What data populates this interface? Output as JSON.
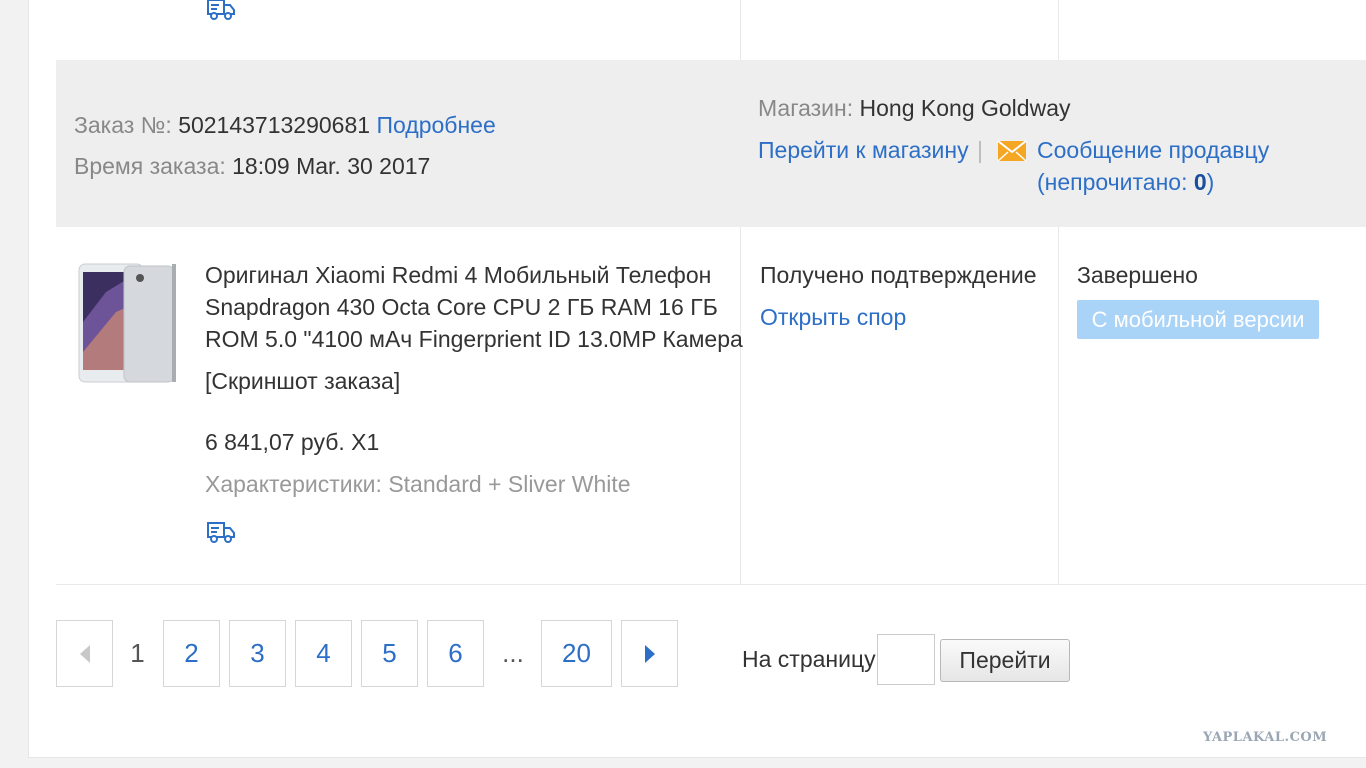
{
  "order": {
    "number_label": "Заказ №:",
    "number_value": "502143713290681",
    "details_link": "Подробнее",
    "time_label": "Время заказа:",
    "time_value": "18:09 Mar. 30 2017",
    "store_label": "Магазин:",
    "store_name": "Hong Kong Goldway",
    "go_to_store": "Перейти к магазину",
    "separator": "|",
    "message_seller": "Сообщение продавцу",
    "unread_prefix": "(непрочитано:",
    "unread_count": "0",
    "unread_suffix": ")"
  },
  "product": {
    "title_line1": "Оригинал Xiaomi Redmi 4 Мобильный Телефон",
    "title_line2": "Snapdragon 430 Octa Core CPU 2 ГБ RAM 16 ГБ",
    "title_line3": "ROM 5.0 \"4100 мАч Fingerprient ID 13.0MP Камера",
    "screenshot_link": "[Скриншот заказа]",
    "price": "6 841,07 руб. X1",
    "specs": "Характеристики: Standard + Sliver White",
    "image_icon": "phone-image"
  },
  "status": {
    "confirmation": "Получено подтверждение",
    "open_dispute": "Открыть спор",
    "order_state": "Завершено",
    "mobile_badge": "С мобильной версии"
  },
  "pagination": {
    "prev_icon": "chevron-left-icon",
    "pages": [
      "1",
      "2",
      "3",
      "4",
      "5",
      "6",
      "...",
      "20"
    ],
    "current": "1",
    "next_icon": "chevron-right-icon",
    "goto_label": "На страницу",
    "goto_value": "",
    "goto_button": "Перейти"
  },
  "icons": {
    "shipping": "truck-icon",
    "message": "envelope-icon"
  },
  "colors": {
    "link": "#2d6fc7",
    "badge": "#a9d3f7",
    "envelope": "#f5a623",
    "header_bg": "#eeeeee"
  },
  "watermark": "YAPLAKAL.COM"
}
